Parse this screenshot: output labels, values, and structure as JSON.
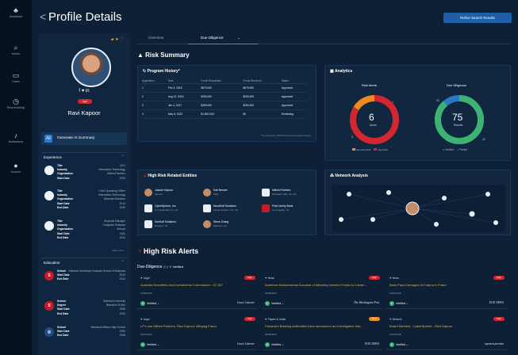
{
  "nav": [
    {
      "label": "Dashboard",
      "icon": "tree-icon"
    },
    {
      "label": "Search",
      "icon": "search-icon"
    },
    {
      "label": "Cases",
      "icon": "folder-icon"
    },
    {
      "label": "Recent Activity",
      "icon": "clock-icon"
    },
    {
      "label": "Notifications",
      "icon": "bell-icon"
    },
    {
      "label": "Account",
      "icon": "avatar-icon"
    }
  ],
  "header": {
    "back": "<",
    "title": "Profile Details",
    "refine_label": "Refine Search Results"
  },
  "profile": {
    "social": "f  ♥  in",
    "risk_pill": "High",
    "name": "Ravi Kapoor",
    "gen_ai_label": "Generate AI Summary",
    "ai_icon": "AI"
  },
  "experience": {
    "title": "Experience",
    "items": [
      {
        "logo": "",
        "rows": [
          [
            "Title",
            "CEO"
          ],
          [
            "Industry",
            "Information Technology"
          ],
          [
            "Organization",
            "MithrA Partners"
          ],
          [
            "Start Date",
            "2020"
          ]
        ]
      },
      {
        "logo": "",
        "rows": [
          [
            "Title",
            "Chief Operating Officer"
          ],
          [
            "Industry",
            "Information Technology"
          ],
          [
            "Organization",
            "Simesoft Solutions"
          ],
          [
            "Start Date",
            "2014"
          ],
          [
            "End Date",
            "2020"
          ]
        ]
      },
      {
        "logo": "",
        "rows": [
          [
            "Title",
            "Regional Manager"
          ],
          [
            "Industry",
            "Computer Software"
          ],
          [
            "Organization",
            "Infosys"
          ],
          [
            "Start Date",
            "2011"
          ],
          [
            "End Date",
            "2014"
          ]
        ]
      }
    ],
    "show_more": "Show more"
  },
  "education": {
    "title": "Education",
    "items": [
      {
        "logo": "S",
        "rows": [
          [
            "School",
            "Stanford University Graduate School of Business"
          ],
          [
            "Start Date",
            "2010"
          ],
          [
            "End Date",
            "2012"
          ]
        ]
      },
      {
        "logo": "S",
        "rows": [
          [
            "School",
            "Stanford University"
          ],
          [
            "Degree",
            "Bachelor Of Arts"
          ],
          [
            "Start Date",
            "1998"
          ],
          [
            "End Date",
            "2002"
          ]
        ]
      },
      {
        "logo": "◎",
        "rows": [
          [
            "School",
            "Woodrow Wilson High School"
          ],
          [
            "Start Date",
            "1994"
          ],
          [
            "End Date",
            "1998"
          ]
        ]
      }
    ]
  },
  "tabs": [
    "Overview",
    "Due Diligence"
  ],
  "risk_summary": {
    "title": "Risk Summary"
  },
  "program_history": {
    "title": "Program History*",
    "columns": [
      "Application",
      "Date",
      "Funds Requested",
      "Funds Received",
      "Status"
    ],
    "rows": [
      [
        "1",
        "Feb 3, 2016",
        "$675,000",
        "$675,000",
        "Approved"
      ],
      [
        "2",
        "Aug 12, 2016",
        "$250,000",
        "$250,000",
        "Approved"
      ],
      [
        "3",
        "Jan 4, 2017",
        "$250,000",
        "$250,000",
        "Approved"
      ],
      [
        "4",
        "May 8, 2022",
        "$1,500,000",
        "$0",
        "Reviewing"
      ]
    ],
    "note": "*Connected to MithrA Partners Program History"
  },
  "analytics": {
    "title": "Analytics",
    "risk_alerts": {
      "label": "Risk Alerts",
      "value": "6",
      "sub": "Alerts",
      "n1": "1",
      "n2": "3",
      "legend": [
        "Elevated Risk",
        "High Risk"
      ]
    },
    "due_diligence": {
      "label": "Due Diligence",
      "value": "75",
      "sub": "Results",
      "n1": "22",
      "n2": "22",
      "legend": [
        "Verified",
        "Partial"
      ]
    }
  },
  "entities": {
    "title": "High Risk Related Entities",
    "items": [
      {
        "name": "Joanne Kapoor",
        "sub": "Spouse",
        "kind": "person"
      },
      {
        "name": "Karl Bender",
        "sub": "CEO",
        "kind": "person"
      },
      {
        "name": "MithrA Partners",
        "sub": "El Dorado Hills, CA, US",
        "kind": "company"
      },
      {
        "name": "CyberSphere, Inc.",
        "sub": "Ft. Lauderdale, FL, US",
        "kind": "company"
      },
      {
        "name": "NovaSoft Solutions",
        "sub": "Grand Junction, CO, US",
        "kind": "company"
      },
      {
        "name": "First Liberty Bank",
        "sub": "Los Angeles, CA",
        "kind": "red"
      },
      {
        "name": "SimSoft Solutions",
        "sub": "Brooklyn, NY",
        "kind": "company"
      },
      {
        "name": "Steve Zhang",
        "sub": "Stanford, CA",
        "kind": "person"
      }
    ]
  },
  "network": {
    "title": "Network Analysis"
  },
  "high_risk_alerts": {
    "title": "High Risk Alerts",
    "subtitle": "Due-Diligence",
    "count": "(10)",
    "verified": "Verified"
  },
  "alerts": [
    {
      "source": "Legal",
      "badge": "High",
      "headline": "Australia Securities and Investments Commission - 07-157",
      "date": "10/30/2020",
      "verify": "Verified",
      "publisher": "Court Listener"
    },
    {
      "source": "News",
      "badge": "High",
      "headline": "American Businessman Accused of Misusing Investor Funds for Lavish...",
      "date": "03/08/2020",
      "verify": "Verified",
      "publisher": "The Washington Post"
    },
    {
      "source": "News",
      "badge": "High",
      "headline": "Bank Pays Damages for Kapoor's Fraud",
      "date": "01/01/2019",
      "verify": "Verified",
      "publisher": "FOX NEWS"
    },
    {
      "source": "Legal",
      "badge": "High",
      "headline": "LP's sue MithrA Partners, Ravi Kapoor, Alleging Fraud",
      "date": "04/01/2020",
      "verify": "Verified",
      "publisher": "Court Listener"
    },
    {
      "source": "Papers & Leaks",
      "badge": "Med",
      "headline": "Panama's Banking Authorities have announced an investigation into...",
      "date": "06/08/2020",
      "verify": "Verified",
      "publisher": "FOX NEWS"
    },
    {
      "source": "Network",
      "badge": "High",
      "headline": "Board Member - CyberSphere - Ravi Kapoor",
      "date": "12/01/2018",
      "verify": "Verified",
      "publisher": "opencorporates"
    }
  ],
  "colors": {
    "accent": "#1f5fa8",
    "high": "#d3262f",
    "elevated": "#f08a1d",
    "verified": "#3cb371",
    "partial": "#2a79c9",
    "headline": "#e7b53b"
  }
}
